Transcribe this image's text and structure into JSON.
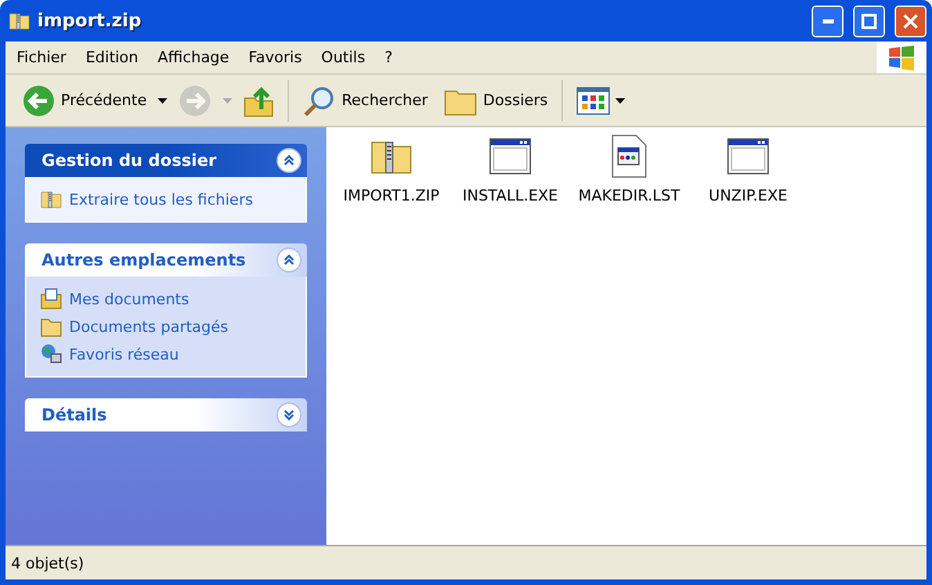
{
  "window": {
    "title": "import.zip"
  },
  "menu": [
    "Fichier",
    "Edition",
    "Affichage",
    "Favoris",
    "Outils",
    "?"
  ],
  "toolbar": [
    {
      "kind": "back",
      "label": "Précédente"
    },
    {
      "kind": "forward",
      "disabled": true
    },
    {
      "kind": "up"
    },
    {
      "kind": "search",
      "label": "Rechercher"
    },
    {
      "kind": "folders",
      "label": "Dossiers"
    },
    {
      "kind": "views"
    }
  ],
  "tasks": [
    {
      "title": "Gestion du dossier",
      "expanded": true,
      "special": true,
      "items": [
        {
          "kind": "zip",
          "label": "Extraire tous les fichiers"
        }
      ]
    },
    {
      "title": "Autres emplacements",
      "expanded": true,
      "special": false,
      "items": [
        {
          "kind": "documents",
          "label": "Mes documents"
        },
        {
          "kind": "folder",
          "label": "Documents partagés"
        },
        {
          "kind": "network",
          "label": "Favoris réseau"
        }
      ]
    },
    {
      "title": "Détails",
      "expanded": false,
      "special": false
    }
  ],
  "files": [
    {
      "kind": "zip",
      "name": "IMPORT1.ZIP"
    },
    {
      "kind": "exe",
      "name": "INSTALL.EXE"
    },
    {
      "kind": "document",
      "name": "MAKEDIR.LST"
    },
    {
      "kind": "exe",
      "name": "UNZIP.EXE"
    }
  ],
  "status_bar": {
    "text": "4 objet(s)"
  }
}
